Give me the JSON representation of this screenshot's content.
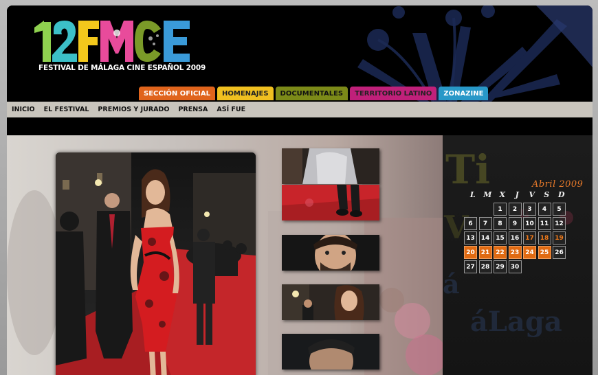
{
  "logo": {
    "text": "12FMCE",
    "subtitle": "FESTIVAL DE MÁLAGA CINE ESPAÑOL 2009"
  },
  "tabs": [
    {
      "label": "SECCIÓN OFICIAL",
      "bg": "#e0641c",
      "fg": "#ffffff"
    },
    {
      "label": "HOMENAJES",
      "bg": "#f0c020",
      "fg": "#222222"
    },
    {
      "label": "DOCUMENTALES",
      "bg": "#7c8a18",
      "fg": "#111111"
    },
    {
      "label": "TERRITORIO LATINO",
      "bg": "#c0207a",
      "fg": "#222222"
    },
    {
      "label": "ZONAZINE",
      "bg": "#2898c8",
      "fg": "#ffffff"
    }
  ],
  "nav": [
    "INICIO",
    "EL FESTIVAL",
    "PREMIOS Y JURADO",
    "PRENSA",
    "ASÍ FUE"
  ],
  "calendar": {
    "title": "Abril 2009",
    "day_headers": [
      "L",
      "M",
      "X",
      "J",
      "V",
      "S",
      "D"
    ],
    "weeks": [
      [
        "",
        "",
        "1",
        "2",
        "3",
        "4",
        "5"
      ],
      [
        "6",
        "7",
        "8",
        "9",
        "10",
        "11",
        "12"
      ],
      [
        "13",
        "14",
        "15",
        "16",
        "17",
        "18",
        "19"
      ],
      [
        "20",
        "21",
        "22",
        "23",
        "24",
        "25",
        "26"
      ],
      [
        "27",
        "28",
        "29",
        "30",
        "",
        "",
        ""
      ]
    ],
    "highlight_text_days": [
      "17",
      "18",
      "19"
    ],
    "highlight_fill_days": [
      "20",
      "21",
      "22",
      "23",
      "24",
      "25"
    ],
    "accent_color": "#e06a12"
  }
}
